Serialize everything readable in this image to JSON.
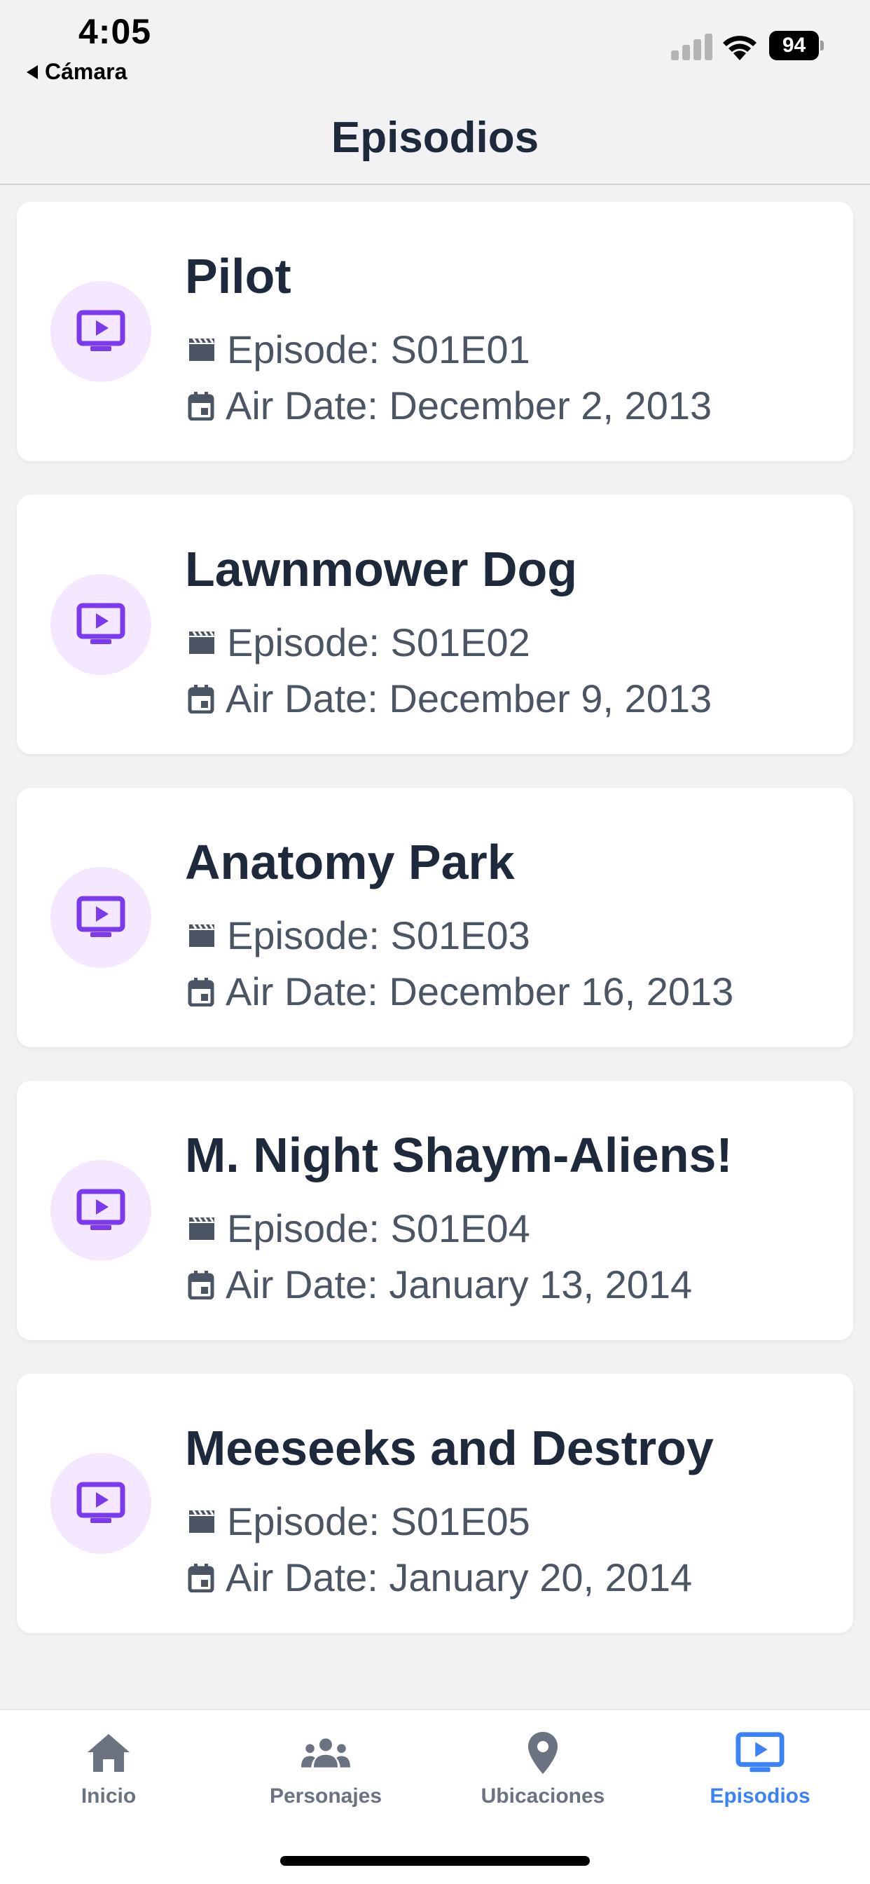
{
  "status_bar": {
    "time": "4:05",
    "back_app": "Cámara",
    "battery": "94"
  },
  "header": {
    "title": "Episodios"
  },
  "episodes": [
    {
      "name": "Pilot",
      "code": "Episode: S01E01",
      "air_date": "Air Date: December 2, 2013"
    },
    {
      "name": "Lawnmower Dog",
      "code": "Episode: S01E02",
      "air_date": "Air Date: December 9, 2013"
    },
    {
      "name": "Anatomy Park",
      "code": "Episode: S01E03",
      "air_date": "Air Date: December 16, 2013"
    },
    {
      "name": "M. Night Shaym-Aliens!",
      "code": "Episode: S01E04",
      "air_date": "Air Date: January 13, 2014"
    },
    {
      "name": "Meeseeks and Destroy",
      "code": "Episode: S01E05",
      "air_date": "Air Date: January 20, 2014"
    }
  ],
  "tabs": [
    {
      "label": "Inicio",
      "icon": "home-icon",
      "active": false
    },
    {
      "label": "Personajes",
      "icon": "people-icon",
      "active": false
    },
    {
      "label": "Ubicaciones",
      "icon": "location-pin-icon",
      "active": false
    },
    {
      "label": "Episodios",
      "icon": "tv-play-icon",
      "active": true
    }
  ],
  "colors": {
    "accent": "#3b82f6",
    "episode_icon": "#7c3aed",
    "episode_icon_bg": "#f3e8ff",
    "tab_inactive": "#6b7280"
  }
}
